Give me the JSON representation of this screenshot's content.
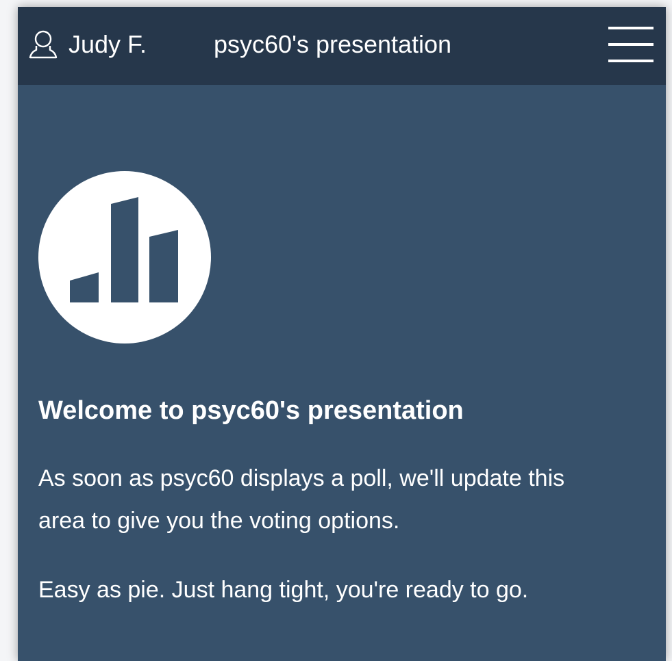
{
  "header": {
    "user_name": "Judy F.",
    "presentation_title": "psyc60's presentation",
    "user_icon": "user-icon",
    "menu_icon": "hamburger-menu-icon"
  },
  "main": {
    "logo_icon": "bar-chart-logo-icon",
    "welcome_heading": "Welcome to psyc60's presentation",
    "info_line_1": "As soon as psyc60 displays a poll, we'll update this",
    "info_line_2": "area to give you the voting options.",
    "ready_text": "Easy as pie. Just hang tight, you're ready to go."
  },
  "colors": {
    "header_bg": "#26374b",
    "content_bg": "#37516b",
    "text": "#ffffff"
  }
}
